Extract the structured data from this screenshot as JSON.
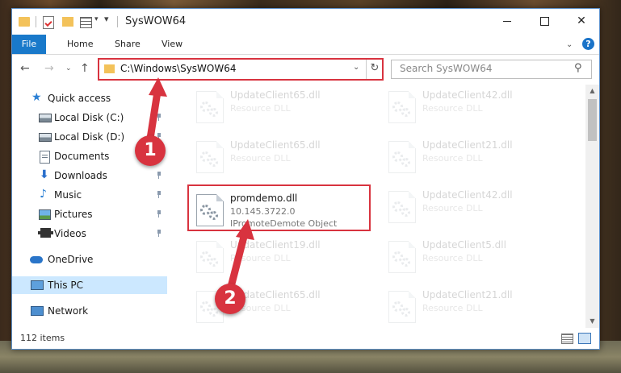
{
  "window": {
    "title": "SysWOW64",
    "qa_dropdown": "▾",
    "minimize": "",
    "maximize": "",
    "close": "✕"
  },
  "ribbon": {
    "tabs": [
      "File",
      "Home",
      "Share",
      "View"
    ],
    "expand": "⌄",
    "help": "?"
  },
  "nav": {
    "back": "←",
    "forward": "→",
    "recent": "⌄",
    "up": "↑",
    "address": "C:\\Windows\\SysWOW64",
    "address_drop": "⌄",
    "refresh": "↻",
    "search_placeholder": "Search SysWOW64",
    "search_icon": "⚲"
  },
  "sidebar": {
    "items": [
      {
        "label": "Quick access",
        "icon": "star-icon"
      },
      {
        "label": "Local Disk (C:)",
        "icon": "drive-icon"
      },
      {
        "label": "Local Disk (D:)",
        "icon": "drive-icon"
      },
      {
        "label": "Documents",
        "icon": "documents-icon"
      },
      {
        "label": "Downloads",
        "icon": "downloads-icon"
      },
      {
        "label": "Music",
        "icon": "music-icon"
      },
      {
        "label": "Pictures",
        "icon": "pictures-icon"
      },
      {
        "label": "Videos",
        "icon": "videos-icon"
      },
      {
        "label": "OneDrive",
        "icon": "onedrive-icon"
      },
      {
        "label": "This PC",
        "icon": "pc-icon"
      },
      {
        "label": "Network",
        "icon": "network-icon"
      }
    ]
  },
  "files": {
    "left": [
      {
        "name": "UpdateClient65.dll",
        "type": "Resource DLL"
      },
      {
        "name": "UpdateClient65.dll",
        "type": "Resource DLL"
      },
      {
        "name": "UpdateClient19.dll",
        "type": "Resource DLL"
      },
      {
        "name": "UpdateClient65.dll",
        "type": "Resource DLL"
      }
    ],
    "right": [
      {
        "name": "UpdateClient42.dll",
        "type": "Resource DLL"
      },
      {
        "name": "UpdateClient21.dll",
        "type": "Resource DLL"
      },
      {
        "name": "UpdateClient42.dll",
        "type": "Resource DLL"
      },
      {
        "name": "UpdateClient5.dll",
        "type": "Resource DLL"
      },
      {
        "name": "UpdateClient21.dll",
        "type": "Resource DLL"
      }
    ],
    "highlighted": {
      "name": "promdemo.dll",
      "version": "10.145.3722.0",
      "description": "IPromoteDemote Object"
    }
  },
  "scroll": {
    "up": "▲",
    "down": "▼"
  },
  "status": {
    "items": "112 items"
  },
  "annotations": {
    "step1": "1",
    "step2": "2"
  },
  "colors": {
    "accent": "#1979ca",
    "highlight": "#d8333f",
    "selected": "#cce8ff"
  }
}
